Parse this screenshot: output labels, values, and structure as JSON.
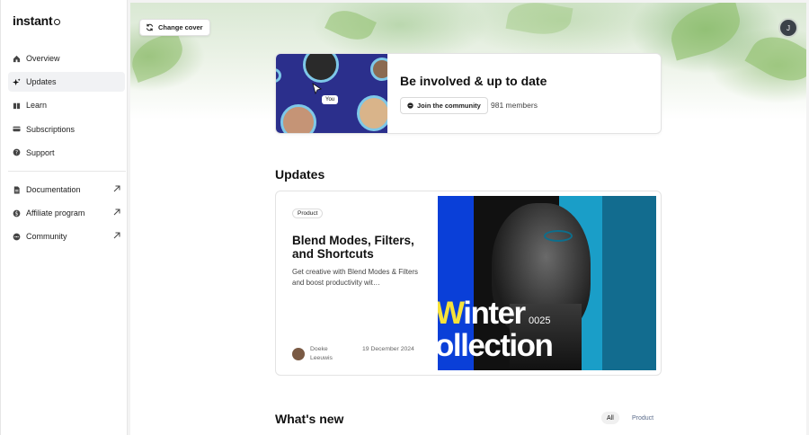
{
  "app": {
    "logo": "instant"
  },
  "sidebar": {
    "items": [
      {
        "label": "Overview",
        "icon": "home-icon"
      },
      {
        "label": "Updates",
        "icon": "sparkle-icon",
        "active": true
      },
      {
        "label": "Learn",
        "icon": "book-icon"
      },
      {
        "label": "Subscriptions",
        "icon": "card-icon"
      },
      {
        "label": "Support",
        "icon": "help-icon"
      }
    ],
    "links": [
      {
        "label": "Documentation",
        "icon": "document-icon"
      },
      {
        "label": "Affiliate program",
        "icon": "dollar-icon"
      },
      {
        "label": "Community",
        "icon": "chat-icon"
      }
    ]
  },
  "header": {
    "change_cover_label": "Change cover",
    "avatar_initial": "J"
  },
  "community": {
    "title": "Be involved & up to date",
    "join_label": "Join the community",
    "members": "981 members",
    "you_label": "You"
  },
  "updates": {
    "heading": "Updates",
    "card": {
      "tag": "Product",
      "title": "Blend Modes, Filters, and Shortcuts",
      "description": "Get creative with Blend Modes & Filters and boost productivity wit…",
      "author": "Doeke Leeuwis",
      "date": "19 December 2024",
      "image_text_line1_accent": "W",
      "image_text_line1": "inter",
      "image_text_line2": "ollection",
      "image_year": "0025"
    }
  },
  "whats_new": {
    "heading": "What's new",
    "filters": [
      "All",
      "Product"
    ]
  },
  "colors": {
    "accent_blue": "#0a3fd8",
    "teal": "#1a9ec8",
    "yellow": "#f7e23a"
  }
}
